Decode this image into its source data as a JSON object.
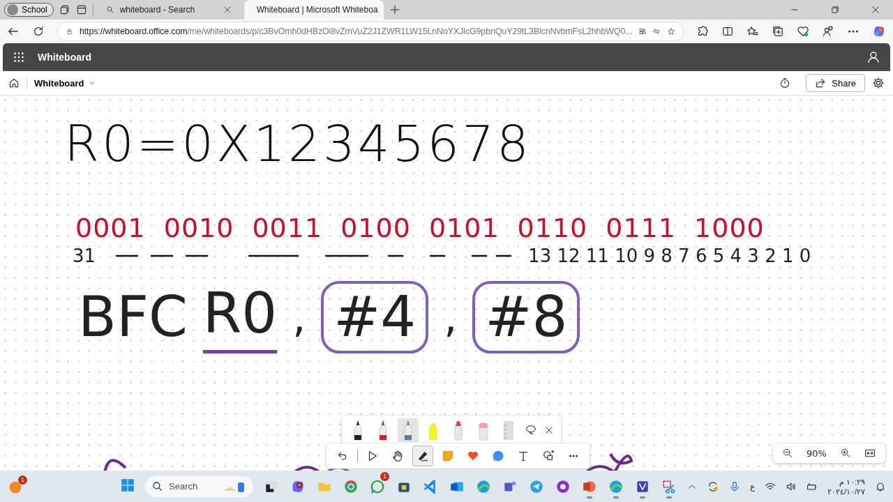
{
  "browser": {
    "profile": "School",
    "tabs": [
      {
        "title": "whiteboard - Search",
        "selected": false
      },
      {
        "title": "Whiteboard | Microsoft Whiteboa",
        "selected": true
      }
    ],
    "url_host": "https://whiteboard.office.com",
    "url_path": "/me/whiteboards/p/c3BvOmh0dHBzOi8vZmVuZ2J1ZWR1LW15LnNoYXJlcG9pbnQuY29tL3BlcnNvbmFsL2hhbWQ0..."
  },
  "app": {
    "title": "Whiteboard",
    "board_name": "Whiteboard",
    "share": "Share"
  },
  "ink": [
    {
      "kind": "formula",
      "text": "R0=0X12345678"
    },
    {
      "kind": "binary",
      "groups": [
        "0001",
        "0010",
        "0011",
        "0100",
        "0101",
        "0110",
        "0111",
        "1000"
      ]
    },
    {
      "kind": "bits",
      "start": "31",
      "end": "13 12 11 10 9 8 7 6 5 4 3 2 1 0"
    },
    {
      "kind": "instruction",
      "mnemonic": "BFC",
      "register": "R0",
      "separator": ",",
      "operands": [
        "#4",
        "#8"
      ]
    }
  ],
  "pens": [
    {
      "kind": "pen",
      "color": "#222222",
      "selected": false
    },
    {
      "kind": "pen",
      "color": "#d0202a",
      "selected": false
    },
    {
      "kind": "pen",
      "color": "#5a7fa8",
      "selected": true
    },
    {
      "kind": "highlighter",
      "color": "#f2f230",
      "selected": false
    },
    {
      "kind": "laser",
      "color": "#e04060",
      "selected": false
    },
    {
      "kind": "eraser",
      "color": "#f0a0b0",
      "selected": false
    },
    {
      "kind": "ruler",
      "color": "#dddddd",
      "selected": false
    }
  ],
  "tools": [
    {
      "kind": "select",
      "selected": false
    },
    {
      "kind": "hand",
      "selected": false
    },
    {
      "kind": "ink",
      "selected": true
    },
    {
      "kind": "note",
      "selected": false
    },
    {
      "kind": "reaction",
      "selected": false
    },
    {
      "kind": "comment",
      "selected": false
    },
    {
      "kind": "text",
      "selected": false
    },
    {
      "kind": "shapes",
      "selected": false
    },
    {
      "kind": "more",
      "selected": false
    }
  ],
  "zoom": "90%",
  "taskbar": {
    "notification_count": "1",
    "search": "Search",
    "whatsapp_count": "1",
    "apps": [
      {
        "kind": "taskview",
        "active": false
      },
      {
        "kind": "copilot",
        "active": false
      },
      {
        "kind": "folder",
        "active": false
      },
      {
        "kind": "chrome",
        "active": false
      },
      {
        "kind": "whatsapp",
        "active": false
      },
      {
        "kind": "store",
        "active": false
      },
      {
        "kind": "vscode",
        "active": false
      },
      {
        "kind": "outlook",
        "active": false
      },
      {
        "kind": "edge-beta",
        "active": false
      },
      {
        "kind": "teams",
        "active": false
      },
      {
        "kind": "telegram",
        "active": false
      },
      {
        "kind": "circle",
        "active": false
      },
      {
        "kind": "powerpoint",
        "active": true
      },
      {
        "kind": "edge",
        "active": true
      },
      {
        "kind": "vpn",
        "active": true
      },
      {
        "kind": "snip",
        "active": true
      }
    ],
    "language": "ع",
    "time": "١٠:٢٩ م",
    "date": "٢٠٢٤/١٠/٢٧"
  }
}
